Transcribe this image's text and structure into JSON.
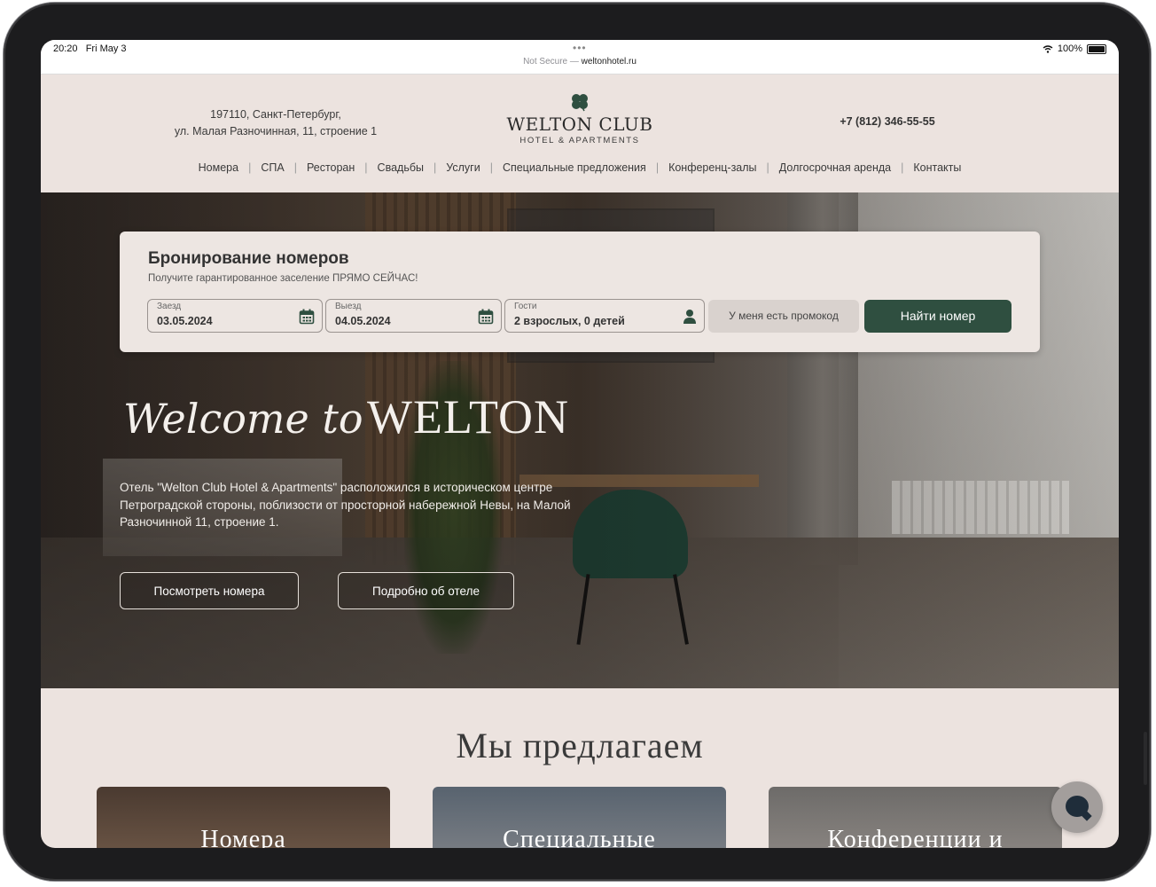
{
  "status_bar": {
    "time": "20:20",
    "date": "Fri May 3",
    "battery": "100%"
  },
  "browser": {
    "security": "Not Secure — ",
    "domain": "weltonhotel.ru"
  },
  "header": {
    "address_line1": "197110, Санкт-Петербург,",
    "address_line2": "ул. Малая Разночинная, 11, строение 1",
    "logo_name": "WELTON CLUB",
    "logo_sub": "HOTEL & APARTMENTS",
    "phone": "+7 (812) 346-55-55",
    "nav": [
      "Номера",
      "СПА",
      "Ресторан",
      "Свадьбы",
      "Услуги",
      "Специальные предложения",
      "Конференц-залы",
      "Долгосрочная аренда",
      "Контакты"
    ]
  },
  "booking": {
    "title": "Бронирование номеров",
    "subtitle": "Получите гарантированное заселение ПРЯМО СЕЙЧАС!",
    "checkin_label": "Заезд",
    "checkin_value": "03.05.2024",
    "checkout_label": "Выезд",
    "checkout_value": "04.05.2024",
    "guests_label": "Гости",
    "guests_value": "2 взрослых, 0 детей",
    "promo_label": "У меня есть промокод",
    "find_label": "Найти номер"
  },
  "hero": {
    "welcome_script": "Welcome to",
    "welcome_brand": "WELTON",
    "description": "Отель \"Welton Club Hotel & Apartments\" расположился в историческом центре Петроградской стороны, поблизости от просторной набережной Невы, на Малой Разночинной 11, строение 1.",
    "btn_rooms": "Посмотреть номера",
    "btn_about": "Подробно об отеле"
  },
  "offers": {
    "title": "Мы предлагаем",
    "cards": [
      "Номера",
      "Специальные",
      "Конференции и"
    ]
  },
  "icons": {
    "logo": "clover-icon",
    "calendar": "calendar-icon",
    "guests": "person-icon",
    "chat": "chat-icon",
    "wifi": "wifi-icon"
  },
  "colors": {
    "accent_green": "#2f4f40",
    "page_bg": "#ece3df"
  }
}
